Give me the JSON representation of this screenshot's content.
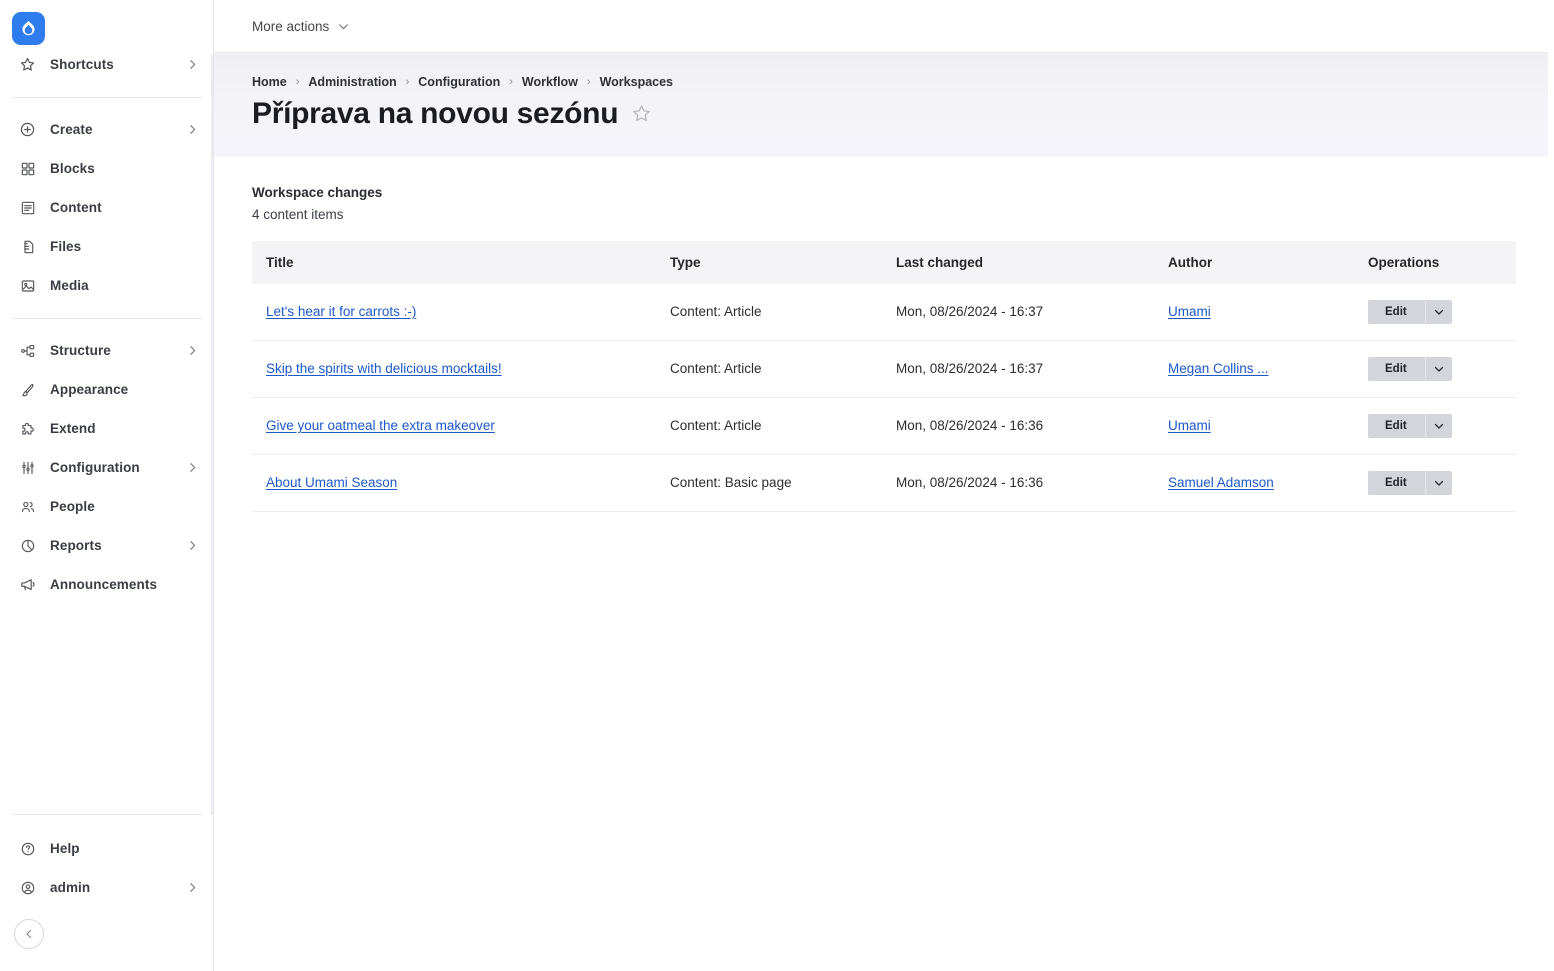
{
  "sidebar": {
    "logo_name": "drupal-logo",
    "groups": [
      {
        "items": [
          {
            "label": "Shortcuts",
            "icon": "star-icon",
            "expandable": true
          }
        ]
      },
      {
        "items": [
          {
            "label": "Create",
            "icon": "plus-circle-icon",
            "expandable": true
          },
          {
            "label": "Blocks",
            "icon": "blocks-icon",
            "expandable": false
          },
          {
            "label": "Content",
            "icon": "content-icon",
            "expandable": false
          },
          {
            "label": "Files",
            "icon": "files-icon",
            "expandable": false
          },
          {
            "label": "Media",
            "icon": "media-icon",
            "expandable": false
          }
        ]
      },
      {
        "items": [
          {
            "label": "Structure",
            "icon": "structure-icon",
            "expandable": true
          },
          {
            "label": "Appearance",
            "icon": "brush-icon",
            "expandable": false
          },
          {
            "label": "Extend",
            "icon": "puzzle-icon",
            "expandable": false
          },
          {
            "label": "Configuration",
            "icon": "sliders-icon",
            "expandable": true
          },
          {
            "label": "People",
            "icon": "people-icon",
            "expandable": false
          },
          {
            "label": "Reports",
            "icon": "chart-pie-icon",
            "expandable": true
          },
          {
            "label": "Announcements",
            "icon": "megaphone-icon",
            "expandable": false
          }
        ]
      }
    ],
    "bottom_items": [
      {
        "label": "Help",
        "icon": "question-circle-icon",
        "expandable": false
      },
      {
        "label": "admin",
        "icon": "user-circle-icon",
        "expandable": true
      }
    ],
    "collapse_label": "collapse-sidebar"
  },
  "topbar": {
    "more_actions_label": "More actions"
  },
  "header": {
    "breadcrumb": [
      {
        "label": "Home"
      },
      {
        "label": "Administration"
      },
      {
        "label": "Configuration"
      },
      {
        "label": "Workflow"
      },
      {
        "label": "Workspaces"
      }
    ],
    "breadcrumb_separator": "›",
    "title": "Příprava na novou sezónu",
    "star_label": "favorite-toggle"
  },
  "main": {
    "section_title": "Workspace changes",
    "section_subtitle": "4 content items",
    "table": {
      "columns": [
        "Title",
        "Type",
        "Last changed",
        "Author",
        "Operations"
      ],
      "rows": [
        {
          "title": "Let's hear it for carrots :-)",
          "type": "Content: Article",
          "last_changed": "Mon, 08/26/2024 - 16:37",
          "author": "Umami",
          "op_label": "Edit"
        },
        {
          "title": "Skip the spirits with delicious mocktails!",
          "type": "Content: Article",
          "last_changed": "Mon, 08/26/2024 - 16:37",
          "author": "Megan Collins ...",
          "op_label": "Edit"
        },
        {
          "title": "Give your oatmeal the extra makeover",
          "type": "Content: Article",
          "last_changed": "Mon, 08/26/2024 - 16:36",
          "author": "Umami",
          "op_label": "Edit"
        },
        {
          "title": "About Umami Season",
          "type": "Content: Basic page",
          "last_changed": "Mon, 08/26/2024 - 16:36",
          "author": "Samuel Adamson",
          "op_label": "Edit"
        }
      ]
    }
  },
  "colors": {
    "brand_blue": "#2e7ced",
    "link_blue": "#1c58c9",
    "header_gradient_start": "#efeff4",
    "table_header_bg": "#f4f4f7",
    "button_grey": "#d4d5da"
  }
}
